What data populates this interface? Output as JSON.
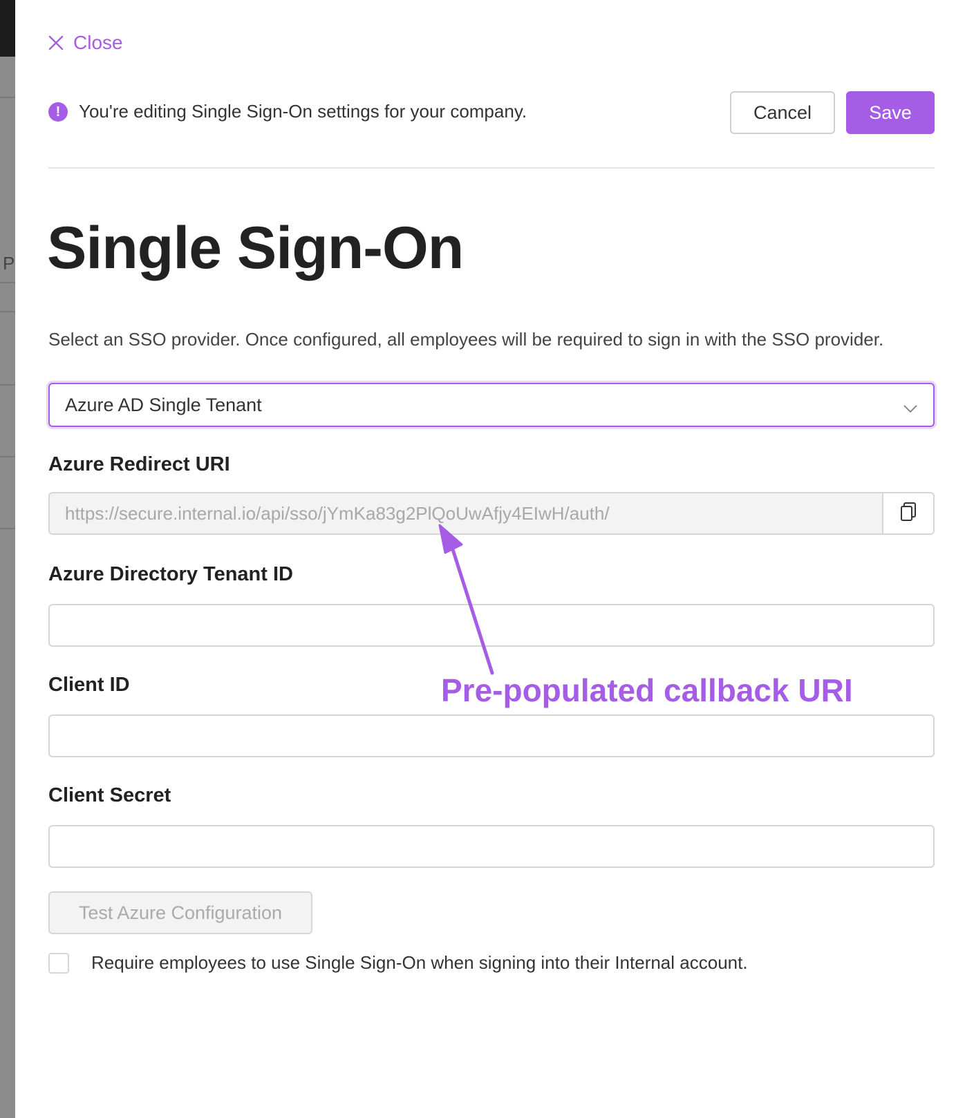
{
  "background": {
    "partial_letter": "P"
  },
  "header": {
    "close_label": "Close",
    "notice_text": "You're editing Single Sign-On settings for your company.",
    "notice_icon": "info-icon",
    "cancel_label": "Cancel",
    "save_label": "Save"
  },
  "page": {
    "title": "Single Sign-On",
    "description": "Select an SSO provider. Once configured, all employees will be required to sign in with the SSO provider."
  },
  "provider_select": {
    "value": "Azure AD Single Tenant",
    "icon": "chevron-down-icon"
  },
  "fields": {
    "redirect_uri": {
      "label": "Azure Redirect URI",
      "value": "https://secure.internal.io/api/sso/jYmKa83g2PlQoUwAfjy4EIwH/auth/",
      "copy_icon": "copy-icon"
    },
    "tenant_id": {
      "label": "Azure Directory Tenant ID",
      "value": ""
    },
    "client_id": {
      "label": "Client ID",
      "value": ""
    },
    "client_secret": {
      "label": "Client Secret",
      "value": ""
    }
  },
  "test_button_label": "Test Azure Configuration",
  "require_sso": {
    "checked": false,
    "label": "Require employees to use Single Sign-On when signing into their Internal account."
  },
  "annotation": {
    "text": "Pre-populated callback URI",
    "color": "#a55de6"
  },
  "colors": {
    "accent": "#a55de6"
  }
}
